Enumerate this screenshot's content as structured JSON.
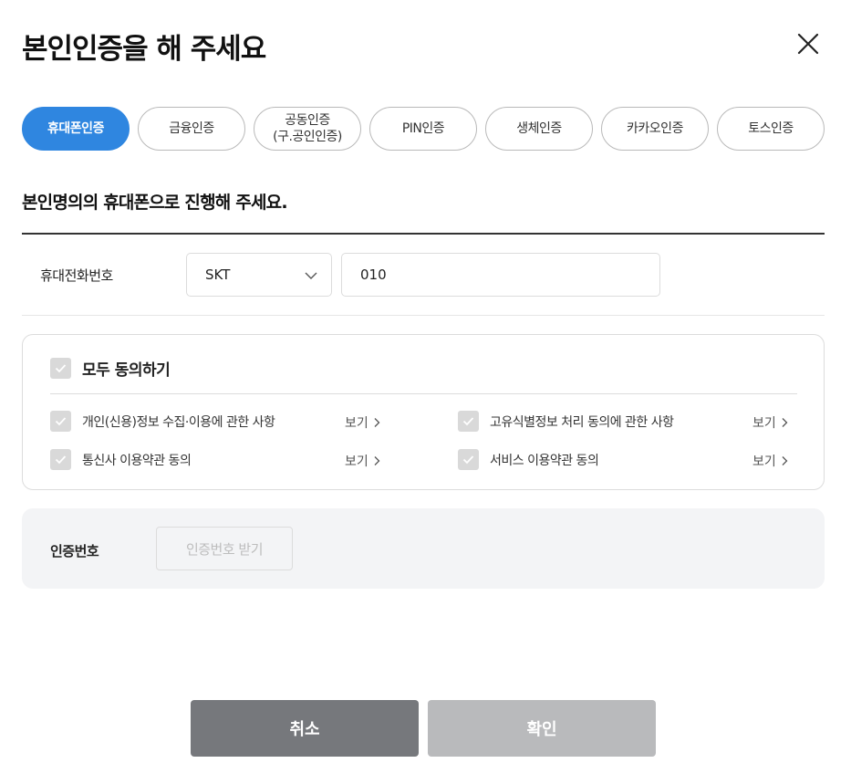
{
  "header": {
    "title": "본인인증을 해 주세요"
  },
  "tabs": [
    {
      "label": "휴대폰인증"
    },
    {
      "label": "금융인증"
    },
    {
      "label": "공동인증\n(구.공인인증)"
    },
    {
      "label": "PIN인증"
    },
    {
      "label": "생체인증"
    },
    {
      "label": "카카오인증"
    },
    {
      "label": "토스인증"
    }
  ],
  "section": {
    "subtitle": "본인명의의 휴대폰으로 진행해 주세요."
  },
  "phone": {
    "label": "휴대전화번호",
    "carrier": "SKT",
    "number": "010"
  },
  "agreements": {
    "all_label": "모두 동의하기",
    "view_label": "보기",
    "items": [
      {
        "label": "개인(신용)정보 수집·이용에 관한 사항"
      },
      {
        "label": "고유식별정보 처리 동의에 관한 사항"
      },
      {
        "label": "통신사 이용약관 동의"
      },
      {
        "label": "서비스 이용약관 동의"
      }
    ]
  },
  "verify": {
    "label": "인증번호",
    "button": "인증번호 받기"
  },
  "footer": {
    "cancel": "취소",
    "confirm": "확인"
  },
  "colors": {
    "accent": "#2f86e0",
    "cancel_bg": "#76787c",
    "confirm_bg": "#b9babc"
  }
}
